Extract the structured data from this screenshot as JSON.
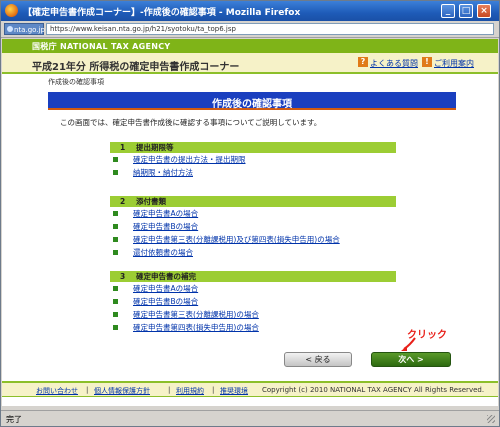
{
  "window": {
    "title": "【確定申告書作成コーナー】-作成後の確認事項 - Mozilla Firefox",
    "minimize": "_",
    "maximize": "□",
    "close": "×"
  },
  "address": {
    "site_badge": "nta.go.jp",
    "url": "https://www.keisan.nta.go.jp/h21/syotoku/ta_top6.jsp"
  },
  "site": {
    "agency": "国税庁 NATIONAL TAX AGENCY",
    "title": "平成21年分 所得税の確定申告書作成コーナー",
    "faq_icon": "?",
    "faq": "よくある質問",
    "guide_icon": "!",
    "guide": "ご利用案内"
  },
  "breadcrumb": "作成後の確認事項",
  "banner": "作成後の確認事項",
  "intro": "この画面では、確定申告書作成後に確認する事項についてご説明しています。",
  "sections": [
    {
      "num": "1",
      "title": "提出期限等",
      "items": [
        "確定申告書の提出方法・提出期限",
        "納期限・納付方法"
      ]
    },
    {
      "num": "2",
      "title": "添付書類",
      "items": [
        "確定申告書Aの場合",
        "確定申告書Bの場合",
        "確定申告書第三表(分離課税用)及び第四表(損失申告用)の場合",
        "還付依頼書の場合"
      ]
    },
    {
      "num": "3",
      "title": "確定申告書の補完",
      "items": [
        "確定申告書Aの場合",
        "確定申告書Bの場合",
        "確定申告書第三表(分離課税用)の場合",
        "確定申告書第四表(損失申告用)の場合"
      ]
    }
  ],
  "buttons": {
    "back": "< 戻る",
    "next": "次へ >"
  },
  "annotation": {
    "text": "クリック",
    "color": "#e8201a"
  },
  "footer": {
    "links": [
      "お問い合わせ",
      "個人情報保護方針",
      "利用規約",
      "推奨環境"
    ],
    "separator": "|",
    "copyright": "Copyright (c) 2010 NATIONAL TAX AGENCY All Rights Reserved."
  },
  "status": "完了",
  "colors": {
    "agency_green": "#7fb418",
    "banner_blue": "#1a3fbf",
    "section_green": "#9ccd34",
    "next_green": "#2d6a10"
  }
}
